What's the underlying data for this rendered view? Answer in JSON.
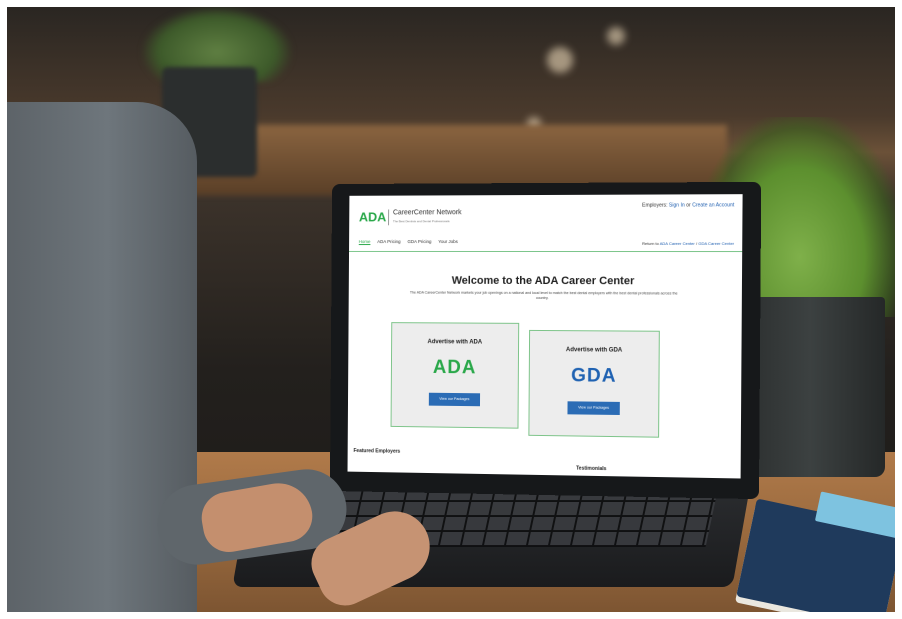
{
  "site": {
    "logo": "ADA",
    "brand_name": "CareerCenter Network",
    "brand_sub": "The Best Dentists and Dental Professionals",
    "employers": {
      "prefix": "Employers:",
      "sign_in": "Sign In",
      "or": "or",
      "create_account": "Create an Account"
    },
    "nav": [
      "Home",
      "ADA Pricing",
      "GDA Pricing",
      "Your Jobs"
    ],
    "return": {
      "prefix": "Return to",
      "link1": "ADA Career Center",
      "sep": "/",
      "link2": "GDA Career Center"
    }
  },
  "hero": {
    "title": "Welcome to the ADA Career Center",
    "description": "The ADA CareerCenter Network markets your job openings on a national and local level to match the best dental employers with the best dental professionals across the country."
  },
  "cards": [
    {
      "title": "Advertise with ADA",
      "logo": "ADA",
      "logo_color": "#2aa84a",
      "button": "View our Packages"
    },
    {
      "title": "Advertise with GDA",
      "logo": "GDA",
      "logo_color": "#1f62b2",
      "button": "View our Packages"
    }
  ],
  "sections": {
    "featured": "Featured Employers",
    "testimonials": "Testimonials"
  }
}
